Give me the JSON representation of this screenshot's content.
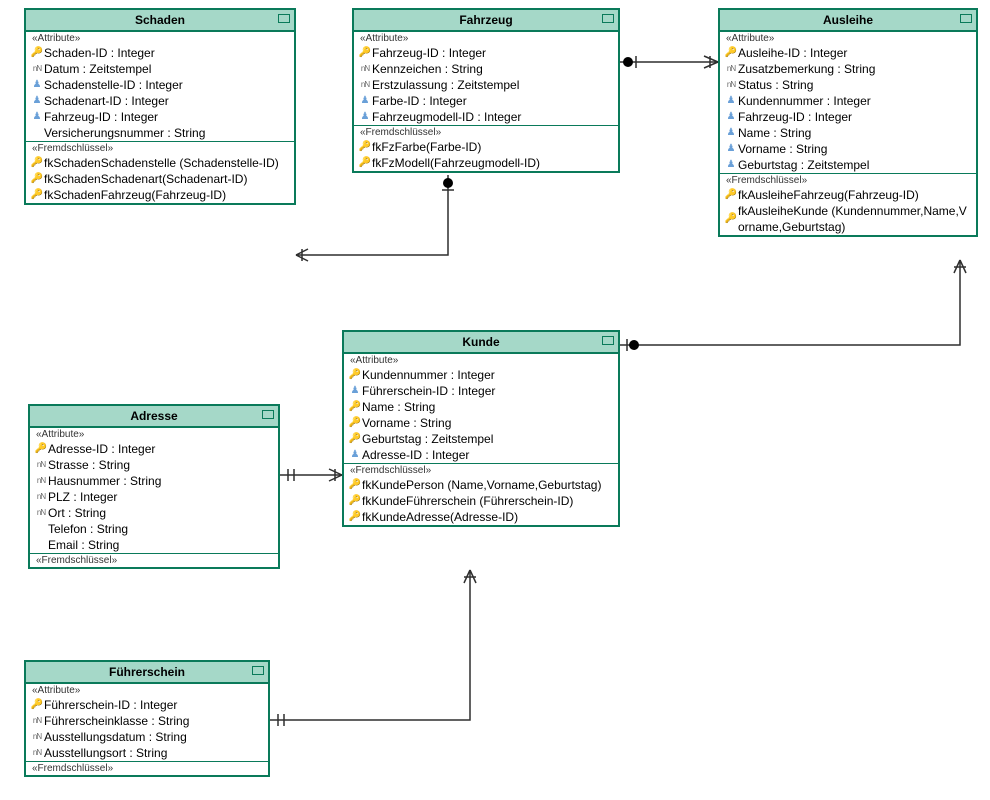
{
  "entities": {
    "schaden": {
      "title": "Schaden",
      "stereotype_attr": "«Attribute»",
      "stereotype_fk": "«Fremdschlüssel»",
      "attrs": [
        {
          "icon": "pk",
          "text": "Schaden-ID : Integer"
        },
        {
          "icon": "nn",
          "text": "Datum : Zeitstempel"
        },
        {
          "icon": "ref",
          "text": "Schadenstelle-ID : Integer"
        },
        {
          "icon": "ref",
          "text": "Schadenart-ID : Integer"
        },
        {
          "icon": "ref",
          "text": "Fahrzeug-ID : Integer"
        },
        {
          "icon": "",
          "text": "Versicherungsnummer : String"
        }
      ],
      "fks": [
        {
          "text": "fkSchadenSchadenstelle (Schadenstelle-ID)"
        },
        {
          "text": "fkSchadenSchadenart(Schadenart-ID)"
        },
        {
          "text": "fkSchadenFahrzeug(Fahrzeug-ID)"
        }
      ]
    },
    "fahrzeug": {
      "title": "Fahrzeug",
      "stereotype_attr": "«Attribute»",
      "stereotype_fk": "«Fremdschlüssel»",
      "attrs": [
        {
          "icon": "pk",
          "text": "Fahrzeug-ID : Integer"
        },
        {
          "icon": "nn",
          "text": "Kennzeichen : String"
        },
        {
          "icon": "nn",
          "text": "Erstzulassung : Zeitstempel"
        },
        {
          "icon": "ref",
          "text": "Farbe-ID : Integer"
        },
        {
          "icon": "ref",
          "text": "Fahrzeugmodell-ID : Integer"
        }
      ],
      "fks": [
        {
          "text": "fkFzFarbe(Farbe-ID)"
        },
        {
          "text": "fkFzModell(Fahrzeugmodell-ID)"
        }
      ]
    },
    "ausleihe": {
      "title": "Ausleihe",
      "stereotype_attr": "«Attribute»",
      "stereotype_fk": "«Fremdschlüssel»",
      "attrs": [
        {
          "icon": "pk",
          "text": "Ausleihe-ID : Integer"
        },
        {
          "icon": "nn",
          "text": "Zusatzbemerkung : String"
        },
        {
          "icon": "nn",
          "text": "Status : String"
        },
        {
          "icon": "ref",
          "text": "Kundennummer : Integer"
        },
        {
          "icon": "ref",
          "text": "Fahrzeug-ID : Integer"
        },
        {
          "icon": "ref",
          "text": "Name : String"
        },
        {
          "icon": "ref",
          "text": "Vorname : String"
        },
        {
          "icon": "ref",
          "text": "Geburtstag : Zeitstempel"
        }
      ],
      "fks": [
        {
          "text": "fkAusleiheFahrzeug(Fahrzeug-ID)"
        },
        {
          "text": "fkAusleiheKunde (Kundennummer,Name,Vorname,Geburtstag)"
        }
      ]
    },
    "kunde": {
      "title": "Kunde",
      "stereotype_attr": "«Attribute»",
      "stereotype_fk": "«Fremdschlüssel»",
      "attrs": [
        {
          "icon": "pk",
          "text": "Kundennummer : Integer"
        },
        {
          "icon": "ref",
          "text": "Führerschein-ID : Integer"
        },
        {
          "icon": "pk2",
          "text": "Name : String"
        },
        {
          "icon": "pk2",
          "text": "Vorname : String"
        },
        {
          "icon": "pk2",
          "text": "Geburtstag : Zeitstempel"
        },
        {
          "icon": "ref",
          "text": "Adresse-ID : Integer"
        }
      ],
      "fks": [
        {
          "text": "fkKundePerson (Name,Vorname,Geburtstag)"
        },
        {
          "text": "fkKundeFührerschein (Führerschein-ID)"
        },
        {
          "text": "fkKundeAdresse(Adresse-ID)"
        }
      ]
    },
    "adresse": {
      "title": "Adresse",
      "stereotype_attr": "«Attribute»",
      "stereotype_fk": "«Fremdschlüssel»",
      "attrs": [
        {
          "icon": "pk",
          "text": "Adresse-ID : Integer"
        },
        {
          "icon": "nn",
          "text": "Strasse : String"
        },
        {
          "icon": "nn",
          "text": "Hausnummer : String"
        },
        {
          "icon": "nn",
          "text": "PLZ : Integer"
        },
        {
          "icon": "nn",
          "text": "Ort : String"
        },
        {
          "icon": "",
          "text": "Telefon : String"
        },
        {
          "icon": "",
          "text": "Email : String"
        }
      ],
      "fks": []
    },
    "fuehrerschein": {
      "title": "Führerschein",
      "stereotype_attr": "«Attribute»",
      "stereotype_fk": "«Fremdschlüssel»",
      "attrs": [
        {
          "icon": "pk",
          "text": "Führerschein-ID : Integer"
        },
        {
          "icon": "nn",
          "text": "Führerscheinklasse : String"
        },
        {
          "icon": "nn",
          "text": "Ausstellungsdatum : String"
        },
        {
          "icon": "nn",
          "text": "Ausstellungsort : String"
        }
      ],
      "fks": []
    }
  }
}
